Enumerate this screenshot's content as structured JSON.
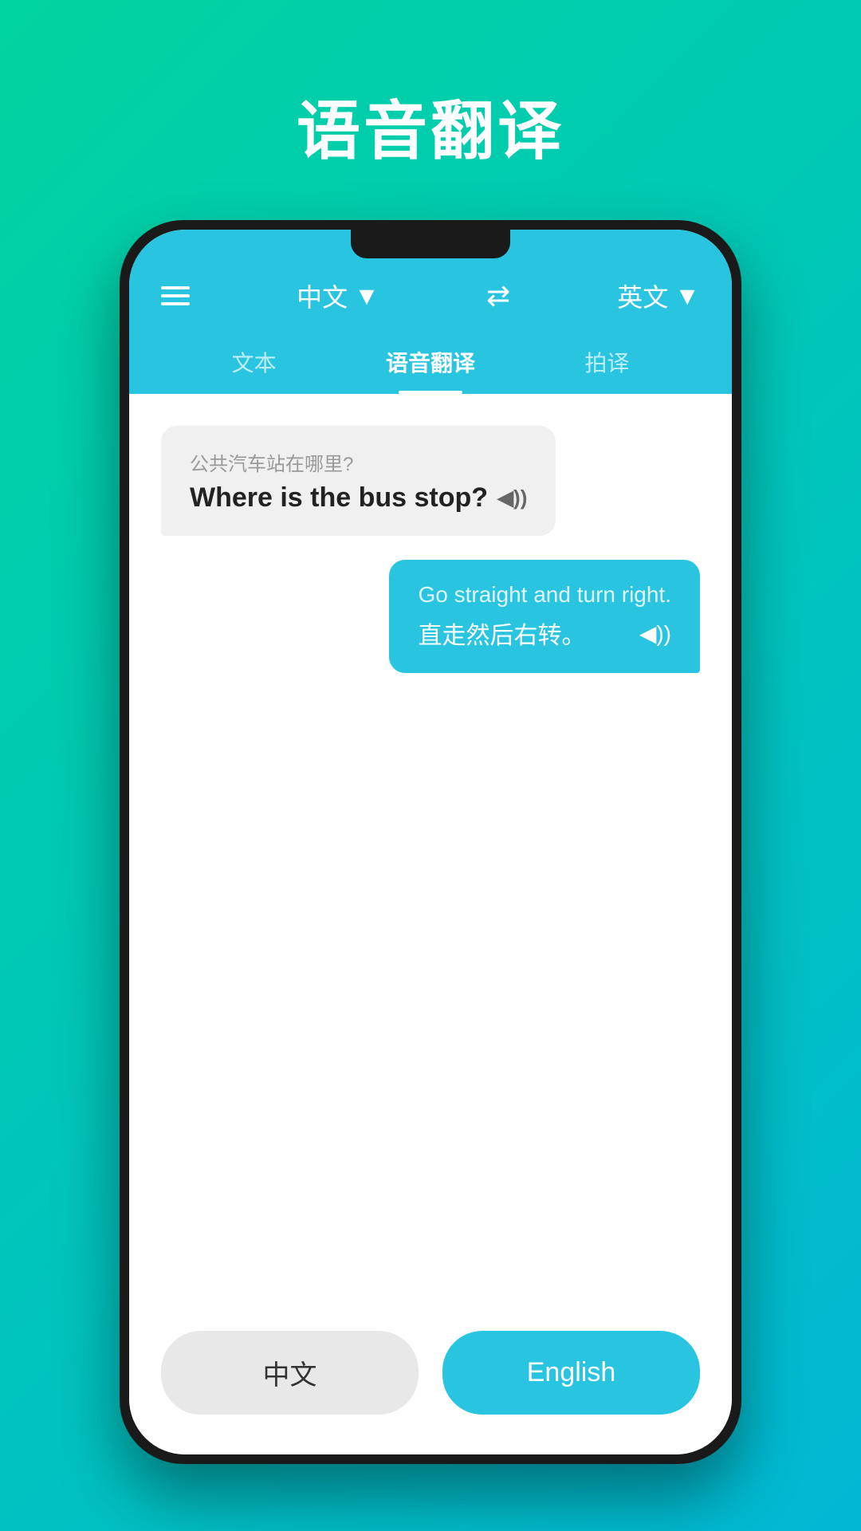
{
  "page": {
    "title": "语音翻译",
    "background": {
      "gradient_start": "#00d4a0",
      "gradient_end": "#00b8d4"
    }
  },
  "header": {
    "source_language": "中文",
    "source_language_arrow": "▼",
    "swap_icon": "⇄",
    "target_language": "英文",
    "target_language_arrow": "▼"
  },
  "tabs": [
    {
      "label": "文本",
      "active": false
    },
    {
      "label": "语音翻译",
      "active": true
    },
    {
      "label": "拍译",
      "active": false
    }
  ],
  "chat": {
    "bubble_left": {
      "original": "公共汽车站在哪里?",
      "translated": "Where is the bus stop?",
      "sound_icon": "◀))"
    },
    "bubble_right": {
      "original": "Go straight and turn right.",
      "translated": "直走然后右转。",
      "sound_icon": "◀))"
    }
  },
  "bottom_buttons": {
    "chinese_label": "中文",
    "english_label": "English"
  },
  "icons": {
    "menu": "hamburger-icon",
    "swap": "swap-languages-icon",
    "sound": "sound-icon"
  }
}
